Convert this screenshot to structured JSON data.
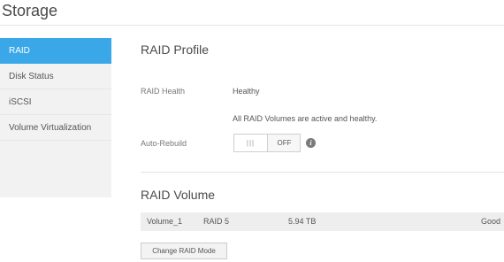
{
  "page": {
    "title": "Storage"
  },
  "sidebar": {
    "items": [
      {
        "label": "RAID",
        "active": true
      },
      {
        "label": "Disk Status"
      },
      {
        "label": "iSCSI"
      },
      {
        "label": "Volume Virtualization"
      }
    ]
  },
  "raid_profile": {
    "title": "RAID Profile",
    "health_label": "RAID Health",
    "health_value": "Healthy",
    "health_detail": "All RAID Volumes are active and healthy.",
    "auto_rebuild_label": "Auto-Rebuild",
    "auto_rebuild_grip": "|||",
    "auto_rebuild_state": "OFF",
    "info_glyph": "i"
  },
  "raid_volume": {
    "title": "RAID Volume",
    "volumes": [
      {
        "name": "Volume_1",
        "mode": "RAID 5",
        "size": "5.94 TB",
        "status": "Good"
      }
    ],
    "change_button": "Change RAID Mode"
  },
  "colors": {
    "accent": "#3aa8e8",
    "sidebar_bg": "#f2f2f2",
    "row_bg": "#eeeeee"
  }
}
